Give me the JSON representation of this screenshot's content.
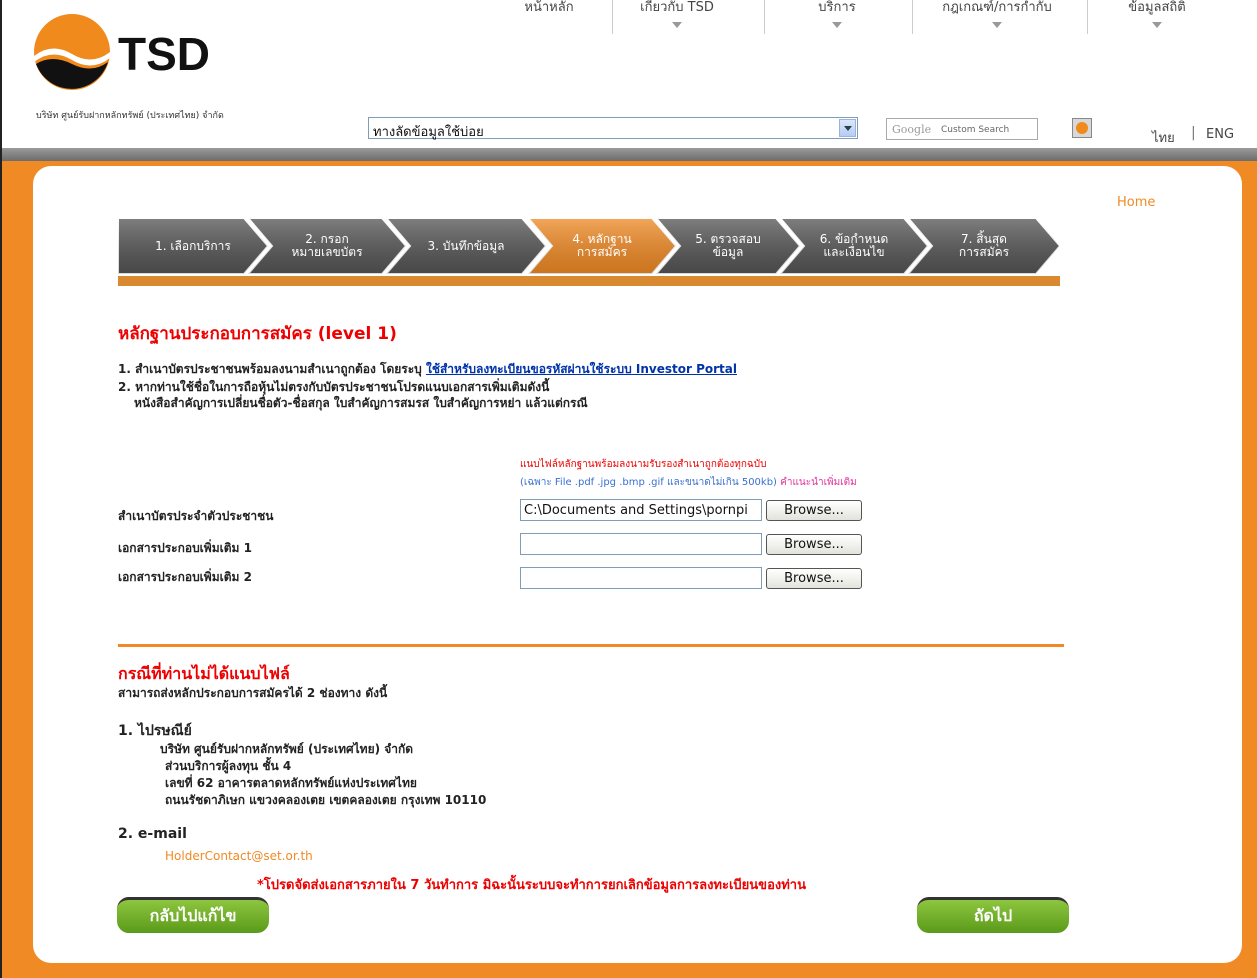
{
  "header": {
    "logo_text": "TSD",
    "company_name": "บริษัท ศูนย์รับฝากหลักทรัพย์ (ประเทศไทย) จำกัด",
    "nav": [
      "หน้าหลัก",
      "เกี่ยวกับ TSD",
      "บริการ",
      "กฎเกณฑ์/การกำกับ",
      "ข้อมูลสถิติ"
    ],
    "quick_select": "ทางลัดข้อมูลใช้บ่อย",
    "search_brand": "Google",
    "search_placeholder": "Custom Search",
    "lang_thai": "ไทย",
    "lang_sep": "|",
    "lang_eng": "ENG"
  },
  "home_link": "Home",
  "steps": [
    {
      "label": "1. เลือกบริการ",
      "active": false
    },
    {
      "label": "2. กรอก\nหมายเลขบัตร",
      "active": false
    },
    {
      "label": "3. บันทึกข้อมูล",
      "active": false
    },
    {
      "label": "4. หลักฐาน\nการสมัคร",
      "active": true
    },
    {
      "label": "5. ตรวจสอบ\nข้อมูล",
      "active": false
    },
    {
      "label": "6. ข้อกำหนด\nและเงื่อนไข",
      "active": false
    },
    {
      "label": "7. สิ้นสุด\nการสมัคร",
      "active": false
    }
  ],
  "colors": {
    "step_active": "#f08a24",
    "step_inactive": "#555555",
    "accent": "#f08a24",
    "alert": "#ee0000",
    "button": "#6fad2a"
  },
  "main": {
    "title": "หลักฐานประกอบการสมัคร (level 1)",
    "note1_prefix": "1. สำเนาบัตรประชาชนพร้อมลงนามสำเนาถูกต้อง โดยระบุ ",
    "note1_link": "ใช้สำหรับลงทะเบียนขอรหัสผ่านใช้ระบบ Investor Portal",
    "note2_line1": "2. หากท่านใช้ชื่อในการถือหุ้นไม่ตรงกับบัตรประชาชนโปรดแนบเอกสารเพิ่มเติมดังนี้",
    "note2_line2": "หนังสือสำคัญการเปลี่ยนชื่อตัว-ชื่อสกุล ใบสำคัญการสมรส ใบสำคัญการหย่า แล้วแต่กรณี",
    "attach_hint": "แนบไฟล์หลักฐานพร้อมลงนามรับรองสำเนาถูกต้องทุกฉบับ",
    "attach_format": "(เฉพาะ File .pdf .jpg .bmp .gif และขนาดไม่เกิน 500kb)",
    "attach_more": "คำแนะนำเพิ่มเติม",
    "files": [
      {
        "label": "สำเนาบัตรประจำตัวประชาชน",
        "value": "C:\\Documents and Settings\\pornpi",
        "browse": "Browse..."
      },
      {
        "label": "เอกสารประกอบเพิ่มเติม 1",
        "value": "",
        "browse": "Browse..."
      },
      {
        "label": "เอกสารประกอบเพิ่มเติม 2",
        "value": "",
        "browse": "Browse..."
      }
    ]
  },
  "no_attach": {
    "title": "กรณีที่ท่านไม่ได้แนบไฟล์",
    "subtitle": "สามารถส่งหลักประกอบการสมัครได้ 2 ช่องทาง ดังนี้",
    "post_title": "1. ไปรษณีย์",
    "post_lines": [
      "บริษัท ศูนย์รับฝากหลักทรัพย์ (ประเทศไทย) จำกัด",
      "ส่วนบริการผู้ลงทุน ชั้น 4",
      "เลขที่ 62 อาคารตลาดหลักทรัพย์แห่งประเทศไทย",
      "ถนนรัชดาภิเษก แขวงคลองเตย เขตคลองเตย กรุงเทพ 10110"
    ],
    "email_title": "2. e-mail",
    "email": "HolderContact@set.or.th",
    "deadline": "*โปรดจัดส่งเอกสารภายใน 7 วันทำการ มิฉะนั้นระบบจะทำการยกเลิกข้อมูลการลงทะเบียนของท่าน"
  },
  "buttons": {
    "back": "กลับไปแก้ไข",
    "next": "ถัดไป"
  }
}
